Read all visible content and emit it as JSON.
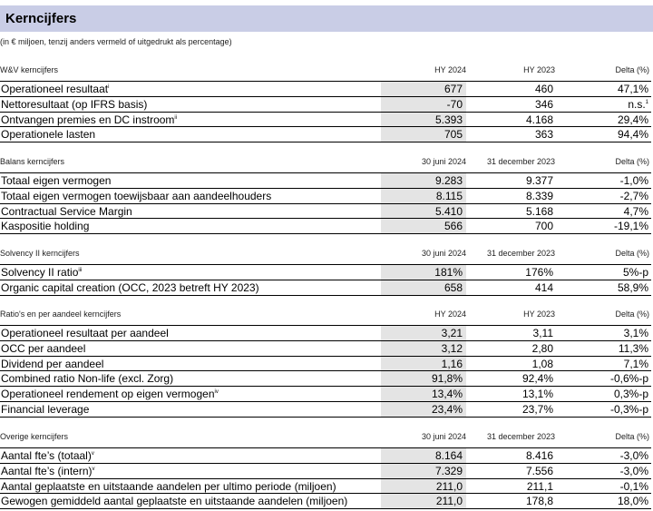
{
  "title": "Kerncijfers",
  "subtitle": "(in € miljoen, tenzij anders vermeld of uitgedrukt als percentage)",
  "sections": [
    {
      "label": "W&V kerncijfers",
      "cols": [
        "HY 2024",
        "HY 2023",
        "Delta (%)"
      ],
      "rows": [
        {
          "label": "Operationeel resultaat",
          "sup": "i",
          "v1": "677",
          "v2": "460",
          "v3": "47,1%",
          "v3sup": ""
        },
        {
          "label": "Nettoresultaat (op IFRS basis)",
          "sup": "",
          "v1": "-70",
          "v2": "346",
          "v3": "n.s.",
          "v3sup": "1"
        },
        {
          "label": "Ontvangen premies en DC instroom",
          "sup": "ii",
          "v1": "5.393",
          "v2": "4.168",
          "v3": "29,4%",
          "v3sup": ""
        },
        {
          "label": "Operationele lasten",
          "sup": "",
          "v1": "705",
          "v2": "363",
          "v3": "94,4%",
          "v3sup": ""
        }
      ]
    },
    {
      "label": "Balans kerncijfers",
      "cols": [
        "30 juni 2024",
        "31 december 2023",
        "Delta (%)"
      ],
      "rows": [
        {
          "label": "Totaal eigen vermogen",
          "sup": "",
          "v1": "9.283",
          "v2": "9.377",
          "v3": "-1,0%",
          "v3sup": ""
        },
        {
          "label": "Totaal eigen vermogen toewijsbaar aan aandeelhouders",
          "sup": "",
          "v1": "8.115",
          "v2": "8.339",
          "v3": "-2,7%",
          "v3sup": ""
        },
        {
          "label": "Contractual Service Margin",
          "sup": "",
          "v1": "5.410",
          "v2": "5.168",
          "v3": "4,7%",
          "v3sup": ""
        },
        {
          "label": "Kaspositie holding",
          "sup": "",
          "v1": "566",
          "v2": "700",
          "v3": "-19,1%",
          "v3sup": ""
        }
      ]
    },
    {
      "label": "Solvency II kerncijfers",
      "cols": [
        "30 juni 2024",
        "31 december 2023",
        "Delta (%)"
      ],
      "rows": [
        {
          "label": "Solvency II ratio",
          "sup": "iii",
          "v1": "181%",
          "v2": "176%",
          "v3": "5%-p",
          "v3sup": ""
        },
        {
          "label": "Organic capital creation (OCC, 2023 betreft HY 2023)",
          "sup": "",
          "v1": "658",
          "v2": "414",
          "v3": "58,9%",
          "v3sup": ""
        }
      ]
    },
    {
      "label": "Ratio's en per aandeel kerncijfers",
      "cols": [
        "HY 2024",
        "HY 2023",
        "Delta (%)"
      ],
      "rows": [
        {
          "label": "Operationeel resultaat per aandeel",
          "sup": "",
          "v1": "3,21",
          "v2": "3,11",
          "v3": "3,1%",
          "v3sup": ""
        },
        {
          "label": "OCC per aandeel",
          "sup": "",
          "v1": "3,12",
          "v2": "2,80",
          "v3": "11,3%",
          "v3sup": ""
        },
        {
          "label": "Dividend per aandeel",
          "sup": "",
          "v1": "1,16",
          "v2": "1,08",
          "v3": "7,1%",
          "v3sup": ""
        },
        {
          "label": "Combined ratio Non-life (excl. Zorg)",
          "sup": "",
          "v1": "91,8%",
          "v2": "92,4%",
          "v3": "-0,6%-p",
          "v3sup": ""
        },
        {
          "label": "Operationeel rendement op eigen vermogen",
          "sup": "iv",
          "v1": "13,4%",
          "v2": "13,1%",
          "v3": "0,3%-p",
          "v3sup": ""
        },
        {
          "label": "Financial leverage",
          "sup": "",
          "v1": "23,4%",
          "v2": "23,7%",
          "v3": "-0,3%-p",
          "v3sup": ""
        }
      ]
    },
    {
      "label": "Overige kerncijfers",
      "cols": [
        "30 juni 2024",
        "31 december 2023",
        "Delta (%)"
      ],
      "rows": [
        {
          "label": "Aantal fte’s (totaal)",
          "sup": "v",
          "v1": "8.164",
          "v2": "8.416",
          "v3": "-3,0%",
          "v3sup": ""
        },
        {
          "label": "Aantal fte’s (intern)",
          "sup": "v",
          "v1": "7.329",
          "v2": "7.556",
          "v3": "-3,0%",
          "v3sup": ""
        },
        {
          "label": "Aantal geplaatste en uitstaande aandelen per ultimo periode (miljoen)",
          "sup": "",
          "v1": "211,0",
          "v2": "211,1",
          "v3": "-0,1%",
          "v3sup": ""
        },
        {
          "label": "Gewogen gemiddeld aantal geplaatste en uitstaande aandelen (miljoen)",
          "sup": "",
          "v1": "211,0",
          "v2": "178,8",
          "v3": "18,0%",
          "v3sup": ""
        }
      ]
    }
  ]
}
